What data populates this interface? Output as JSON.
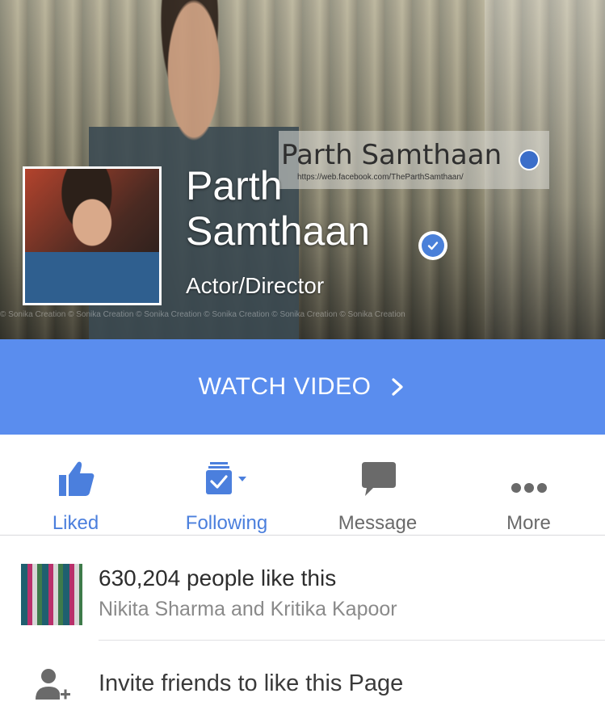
{
  "cover": {
    "watermark_name": "Parth Samthaan",
    "watermark_url": "https://web.facebook.com/TheParthSamthaan/",
    "watermark_strip": "© Sonika Creation   © Sonika Creation   © Sonika Creation   © Sonika Creation   © Sonika Creation   © Sonika Creation"
  },
  "page": {
    "name": "Parth Samthaan",
    "category": "Actor/Director",
    "verified_icon": "verified-check-icon"
  },
  "cta": {
    "label": "WATCH VIDEO",
    "icon": "chevron-right-icon"
  },
  "actions": [
    {
      "label": "Liked",
      "icon": "thumbs-up-icon",
      "active": true
    },
    {
      "label": "Following",
      "icon": "following-icon",
      "active": true
    },
    {
      "label": "Message",
      "icon": "message-icon",
      "active": false
    },
    {
      "label": "More",
      "icon": "more-dots-icon",
      "active": false
    }
  ],
  "likes": {
    "count_text": "630,204 people like this",
    "friends_text": "Nikita Sharma and Kritika Kapoor"
  },
  "invite": {
    "text": "Invite friends to like this Page",
    "icon": "add-person-icon"
  },
  "colors": {
    "accent": "#5a8dee",
    "active_blue": "#4b7fdd",
    "inactive_gray": "#6a6a6a"
  }
}
